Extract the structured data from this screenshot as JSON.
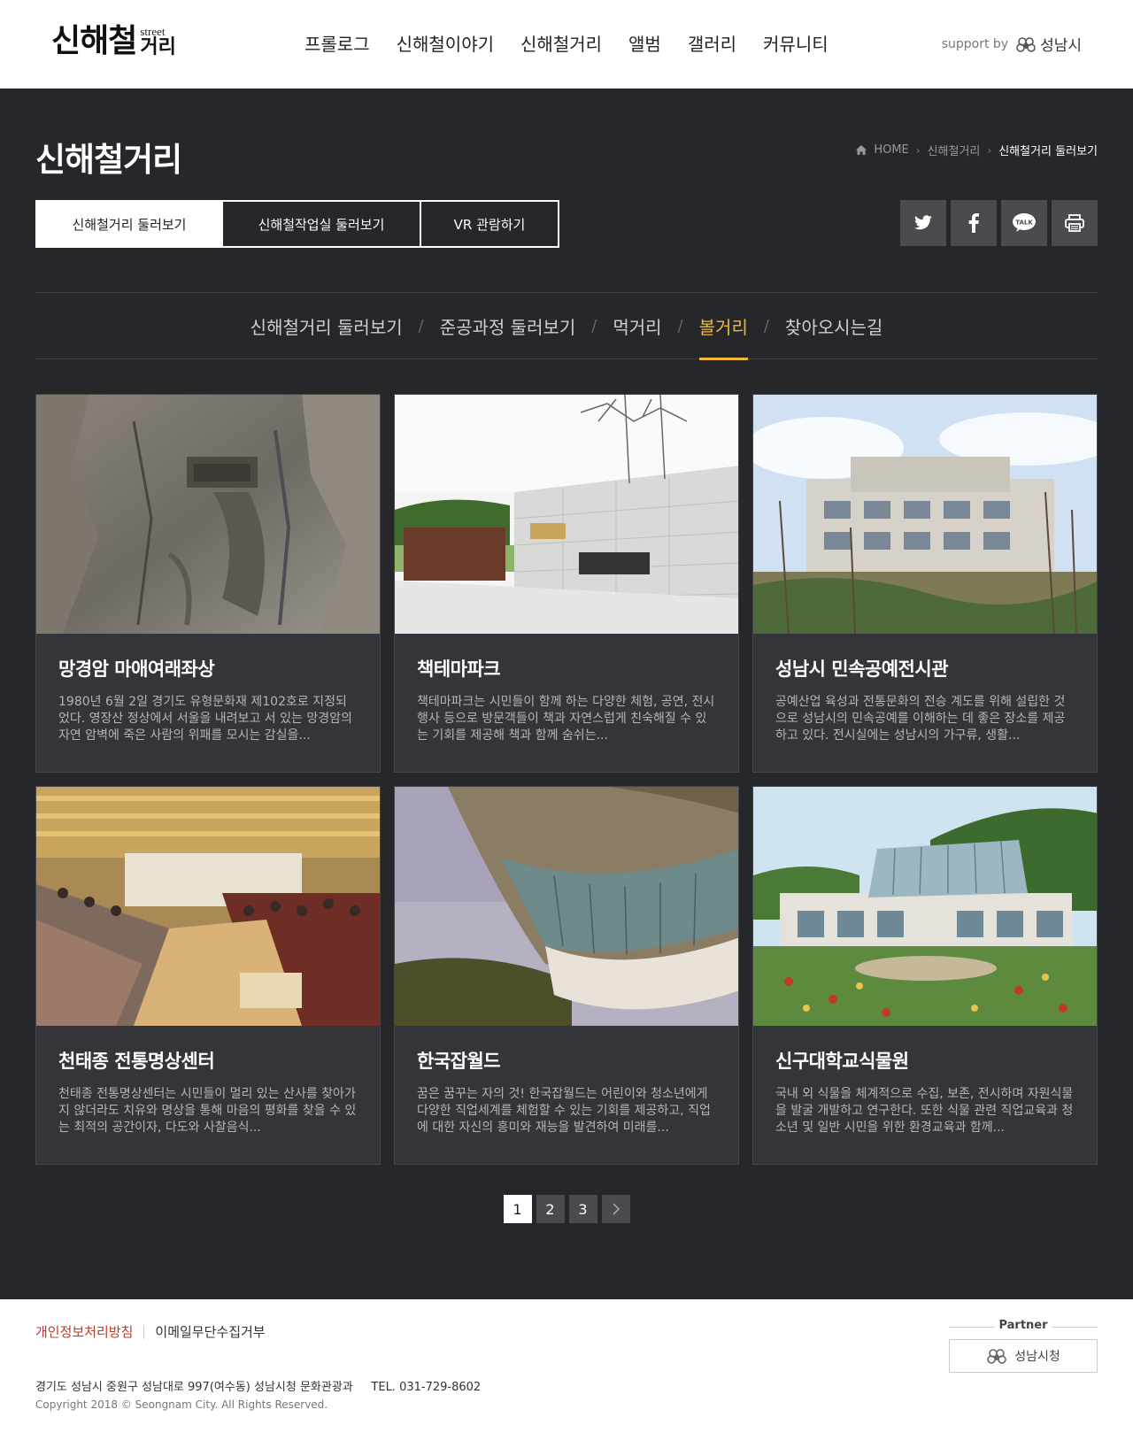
{
  "header": {
    "logo_main": "신해철",
    "logo_street": "street",
    "logo_geori": "거리",
    "nav": [
      "프롤로그",
      "신해철이야기",
      "신해철거리",
      "앨범",
      "갤러리",
      "커뮤니티"
    ],
    "support_text": "support by",
    "support_org": "성남시"
  },
  "page": {
    "title": "신해철거리",
    "breadcrumb": [
      "HOME",
      "신해철거리",
      "신해철거리 둘러보기"
    ]
  },
  "subtabs": [
    "신해철거리 둘러보기",
    "신해철작업실 둘러보기",
    "VR 관람하기"
  ],
  "share_icons": [
    "twitter-icon",
    "facebook-icon",
    "kakaotalk-icon",
    "print-icon"
  ],
  "share_talk_label": "TALK",
  "categories": [
    "신해철거리 둘러보기",
    "준공과정 둘러보기",
    "먹거리",
    "볼거리",
    "찾아오시는길"
  ],
  "category_sep": "/",
  "active_category_index": 3,
  "cards": [
    {
      "title": "망경암 마애여래좌상",
      "desc": "1980년 6월 2일 경기도 유형문화재 제102호로 지정되었다. 영장산 정상에서 서울을 내려보고 서 있는 망경암의 자연 암벽에 죽은 사람의 위패를 모시는 감실을..."
    },
    {
      "title": "책테마파크",
      "desc": "책테마파크는 시민들이 함께 하는 다양한 체험, 공연, 전시행사 등으로 방문객들이 책과 자연스럽게 친숙해질 수 있는 기회를 제공해 책과 함께 숨쉬는..."
    },
    {
      "title": "성남시 민속공예전시관",
      "desc": "공예산업 육성과 전통문화의 전승 계도를 위해 설립한 것으로 성남시의 민속공예를 이해하는 데 좋은 장소를 제공하고 있다. 전시실에는 성남시의 가구류, 생활..."
    },
    {
      "title": "천태종 전통명상센터",
      "desc": "천태종 전통명상센터는 시민들이 멀리 있는 산사를 찾아가지 않더라도 치유와 명상을 통해 마음의 평화를 찾을 수 있는 최적의 공간이자, 다도와 사찰음식..."
    },
    {
      "title": "한국잡월드",
      "desc": "꿈은 꿈꾸는 자의 것! 한국잡월드는 어린이와 청소년에게 다양한 직업세계를 체험할 수 있는 기회를 제공하고, 직업에 대한 자신의 흥미와 재능을 발견하여 미래를..."
    },
    {
      "title": "신구대학교식물원",
      "desc": "국내 외 식물을 체계적으로 수집, 보존, 전시하며 자원식물을 발굴 개발하고 연구한다. 또한 식물 관련 직업교육과 청소년 및 일반 시민을 위한 환경교육과 함께..."
    }
  ],
  "pagination": {
    "pages": [
      "1",
      "2",
      "3"
    ],
    "current": 1,
    "next_icon": "chevron-right-icon"
  },
  "footer": {
    "privacy": "개인정보처리방침",
    "email": "이메일무단수집거부",
    "address": "경기도 성남시 중원구 성남대로 997(여수동) 성남시청 문화관광과     TEL. 031-729-8602",
    "copyright": "Copyright 2018 © Seongnam City. All Rights Reserved.",
    "partner_label": "Partner",
    "partner_name": "성남시청"
  },
  "colors": {
    "accent": "#f0b93a",
    "dark_bg": "#26272b",
    "card_bg": "#34353a",
    "privacy": "#c0392b"
  }
}
